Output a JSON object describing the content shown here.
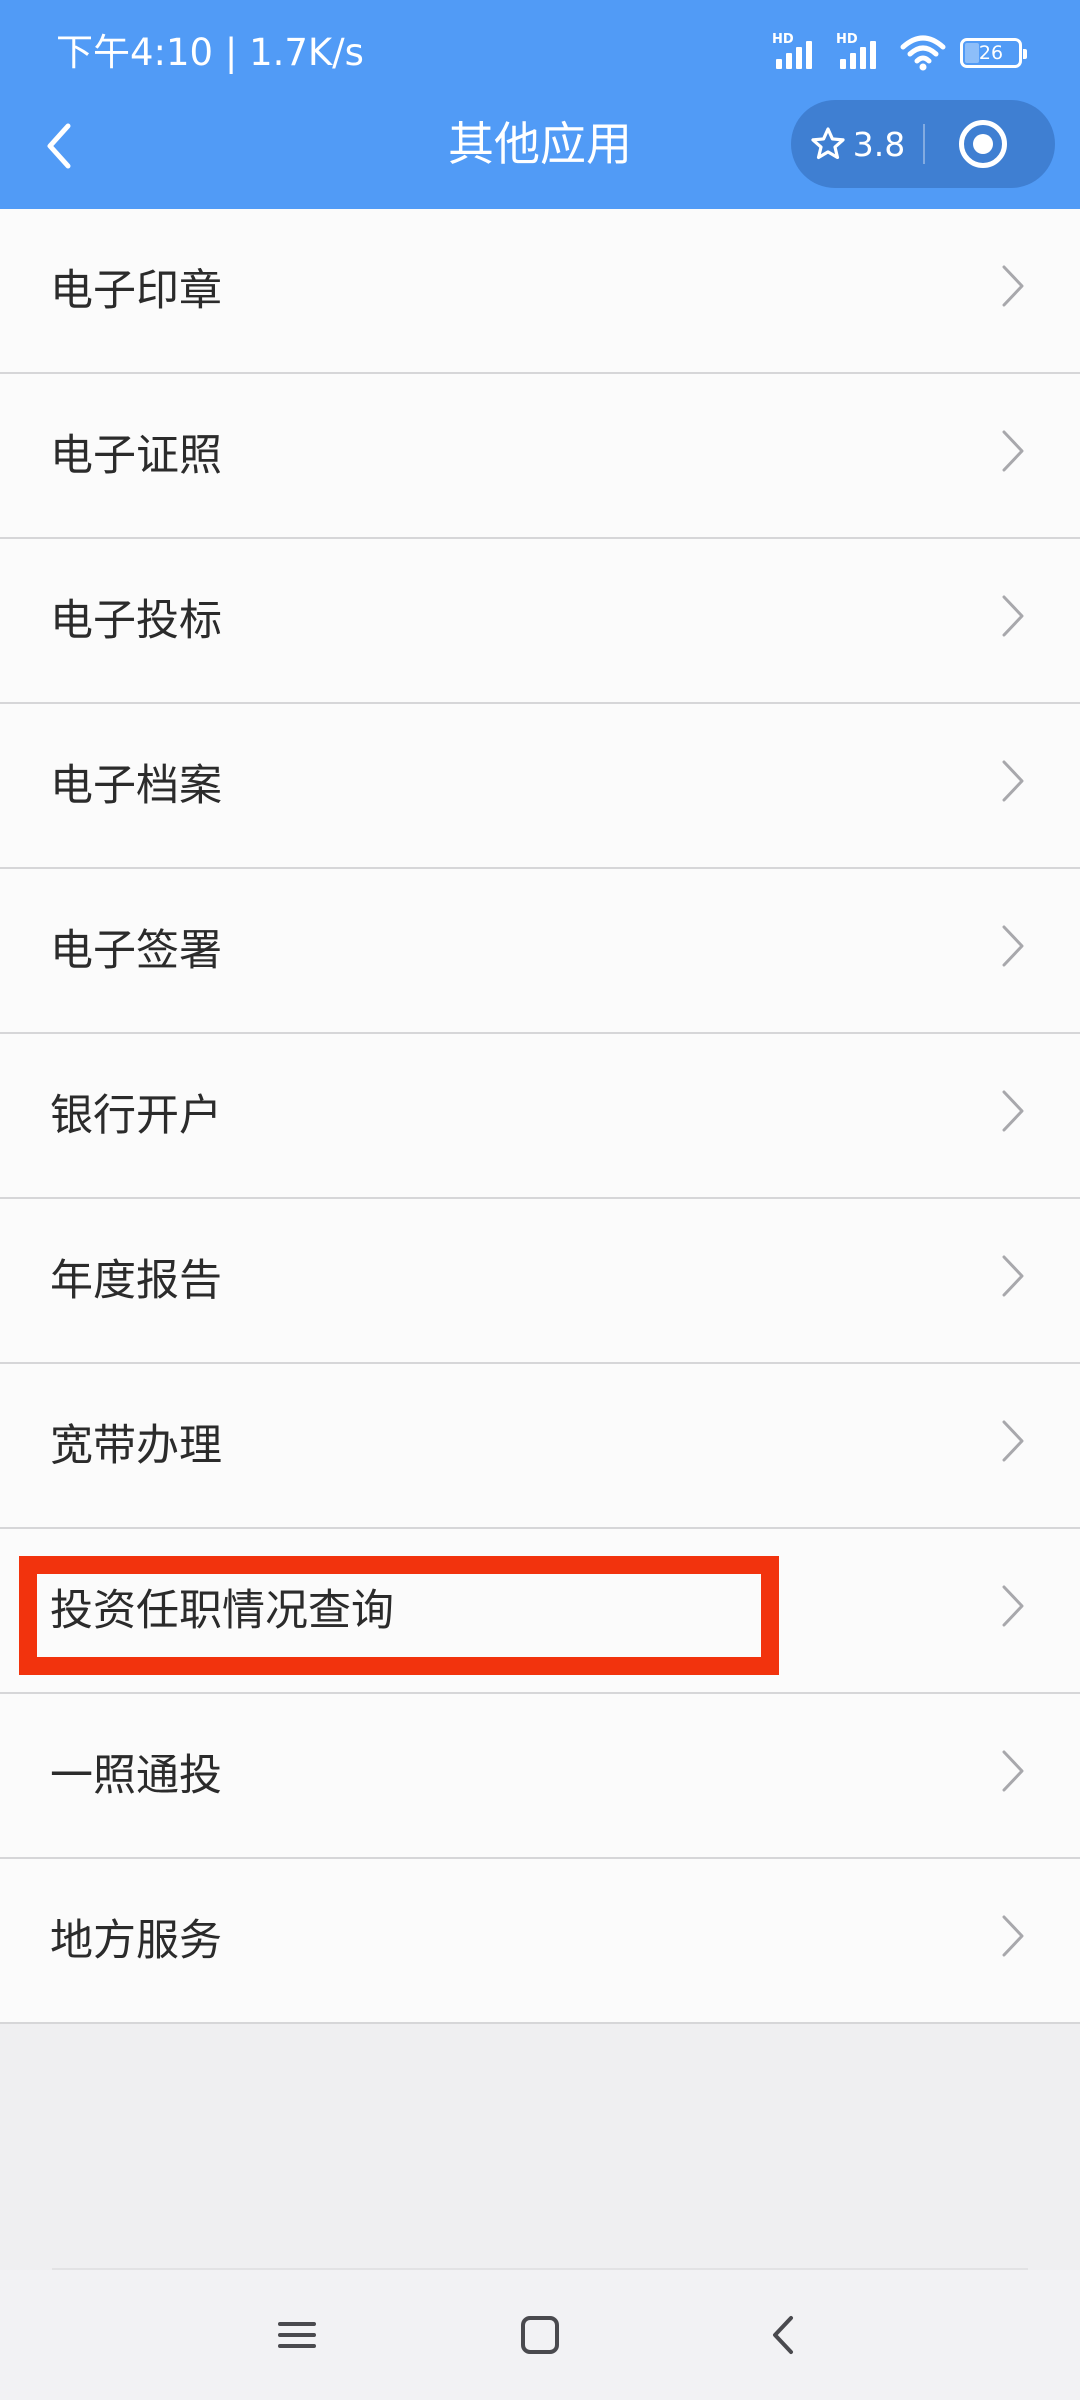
{
  "status_bar": {
    "time_speed": "下午4:10 | 1.7K/s",
    "signal_1_label": "HD",
    "signal_2_label": "HD",
    "battery_level": "26"
  },
  "nav": {
    "title": "其他应用",
    "rating": "3.8",
    "back_icon": "chevron-left-icon",
    "favorite_icon": "star-icon",
    "close_icon": "target-icon"
  },
  "list": {
    "items": [
      {
        "label": "电子印章"
      },
      {
        "label": "电子证照"
      },
      {
        "label": "电子投标"
      },
      {
        "label": "电子档案"
      },
      {
        "label": "电子签署"
      },
      {
        "label": "银行开户"
      },
      {
        "label": "年度报告"
      },
      {
        "label": "宽带办理"
      },
      {
        "label": "投资任职情况查询"
      },
      {
        "label": "一照通投"
      },
      {
        "label": "地方服务"
      }
    ],
    "highlighted_item": "投资任职情况查询"
  },
  "system_nav": {
    "menu_icon": "menu-icon",
    "home_icon": "home-icon",
    "back_icon": "back-icon"
  },
  "colors": {
    "header": "#519bf6",
    "capsule": "#3f7fd2",
    "highlight": "#f2330d",
    "background": "#efeff1"
  }
}
